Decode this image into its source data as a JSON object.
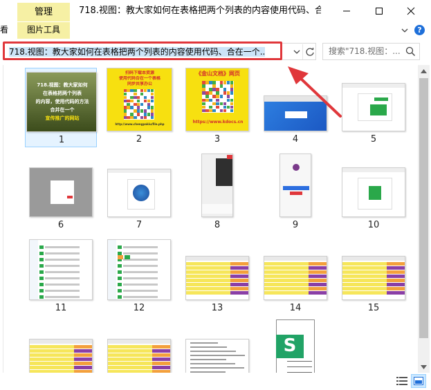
{
  "window": {
    "context_tab": "管理",
    "title": "718.视图：教大家如何在表格把两个列表的内容使用代码、合在...",
    "minimize_label": "—",
    "maximize_label": "□",
    "close_label": "✕"
  },
  "ribbon": {
    "view_tab": "看",
    "picture_tools": "图片工具",
    "help_label": "?"
  },
  "address": {
    "path": "718.视图：教大家如何在表格把两个列表的内容使用代码、合在一个...",
    "search_placeholder": "搜索\"718.视图：..."
  },
  "thumbnails": [
    {
      "label": "1",
      "icon": "image-cover",
      "kind": "cover",
      "caption_lines": [
        "718.视图：教大家如何",
        "在表格把两个列表",
        "的内容，使用代码的方法",
        "合并在一个",
        "宣传推广的网站"
      ]
    },
    {
      "label": "2",
      "icon": "image-qr",
      "kind": "qr",
      "caption_lines": [
        "扫码下载本资源",
        "使用代码合在一个表格",
        "同步共享办公",
        "http://www.chengpakiu/file.php"
      ]
    },
    {
      "label": "3",
      "icon": "image-qr-brand",
      "kind": "qrbrand",
      "caption_lines": [
        "《金山文档》网页",
        "https://www.kdocs.cn"
      ]
    },
    {
      "label": "4",
      "icon": "image-screenshot",
      "kind": "web-blue"
    },
    {
      "label": "5",
      "icon": "image-screenshot",
      "kind": "web-green-dialog"
    },
    {
      "label": "6",
      "icon": "image-screenshot",
      "kind": "gray-dialog"
    },
    {
      "label": "7",
      "icon": "image-screenshot",
      "kind": "qr-dialog"
    },
    {
      "label": "8",
      "icon": "image-screenshot",
      "kind": "phone-menu"
    },
    {
      "label": "9",
      "icon": "image-screenshot",
      "kind": "phone-login"
    },
    {
      "label": "10",
      "icon": "image-screenshot",
      "kind": "green-dialog"
    },
    {
      "label": "11",
      "icon": "image-screenshot",
      "kind": "list-app"
    },
    {
      "label": "12",
      "icon": "image-screenshot",
      "kind": "list-app-2"
    },
    {
      "label": "13",
      "icon": "image-screenshot",
      "kind": "sheet"
    },
    {
      "label": "14",
      "icon": "image-screenshot",
      "kind": "sheet"
    },
    {
      "label": "15",
      "icon": "image-screenshot",
      "kind": "sheet"
    },
    {
      "label": "",
      "icon": "image-screenshot",
      "kind": "sheet-partial"
    },
    {
      "label": "",
      "icon": "image-screenshot",
      "kind": "sheet-partial"
    },
    {
      "label": "",
      "icon": "image-screenshot",
      "kind": "doc-partial"
    },
    {
      "label": "",
      "icon": "spreadsheet-file-icon",
      "kind": "xlsx-icon"
    }
  ],
  "colors": {
    "context_tab_bg": "#f6f0a4",
    "highlight_red": "#e0373b",
    "selection_blue": "#e5f3ff",
    "sheet_yellow": "#f6e65a",
    "sheet_purple": "#8a3fa6",
    "sheet_orange": "#f3a03c",
    "xlsx_green": "#21a366"
  }
}
